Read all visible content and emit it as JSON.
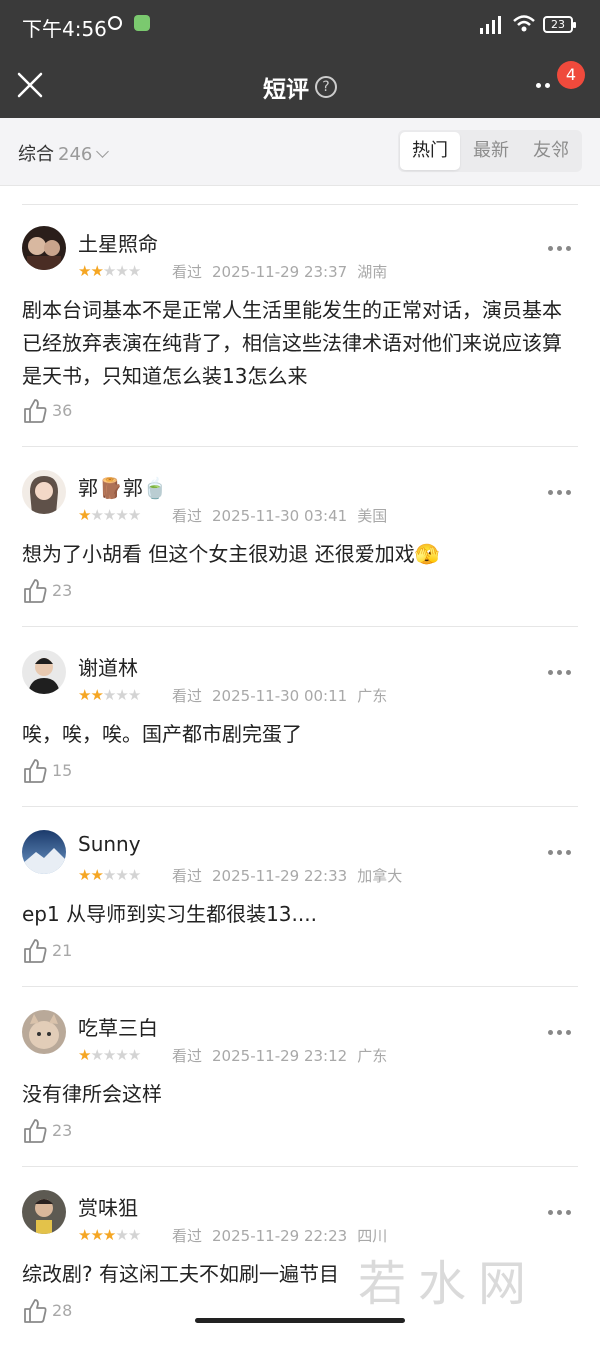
{
  "status_bar": {
    "time": "下午4:56",
    "battery": "23"
  },
  "nav": {
    "title": "短评",
    "help_icon": "?",
    "badge_count": "4"
  },
  "filter": {
    "sort_label": "综合",
    "count": "246",
    "tabs": [
      {
        "label": "热门",
        "active": true
      },
      {
        "label": "最新",
        "active": false
      },
      {
        "label": "友邻",
        "active": false
      }
    ]
  },
  "reviews": [
    {
      "name": "土星照命",
      "stars": 2,
      "watched": "看过",
      "datetime": "2025-11-29 23:37",
      "location": "湖南",
      "content": "剧本台词基本不是正常人生活里能发生的正常对话，演员基本已经放弃表演在纯背了，相信这些法律术语对他们来说应该算是天书，只知道怎么装13怎么来",
      "likes": "36"
    },
    {
      "name": "郭🪵郭🍵",
      "stars": 1,
      "watched": "看过",
      "datetime": "2025-11-30 03:41",
      "location": "美国",
      "content": "想为了小胡看 但这个女主很劝退 还很爱加戏🫣",
      "likes": "23"
    },
    {
      "name": "谢道林",
      "stars": 2,
      "watched": "看过",
      "datetime": "2025-11-30 00:11",
      "location": "广东",
      "content": "唉，唉，唉。国产都市剧完蛋了",
      "likes": "15"
    },
    {
      "name": "Sunny",
      "stars": 2,
      "watched": "看过",
      "datetime": "2025-11-29 22:33",
      "location": "加拿大",
      "content": "ep1 从导师到实习生都很装13....",
      "likes": "21"
    },
    {
      "name": "吃草三白",
      "stars": 1,
      "watched": "看过",
      "datetime": "2025-11-29 23:12",
      "location": "广东",
      "content": "没有律所会这样",
      "likes": "23"
    },
    {
      "name": "赏味狙",
      "stars": 3,
      "watched": "看过",
      "datetime": "2025-11-29 22:23",
      "location": "四川",
      "content": "综改剧? 有这闲工夫不如刷一遍节目",
      "likes": "28"
    }
  ],
  "watermark": "若水网",
  "colors": {
    "header_bg": "#3a3a3a",
    "star": "#f5a623",
    "badge": "#ef4a3c",
    "filter_bg": "#f4f4f6"
  }
}
